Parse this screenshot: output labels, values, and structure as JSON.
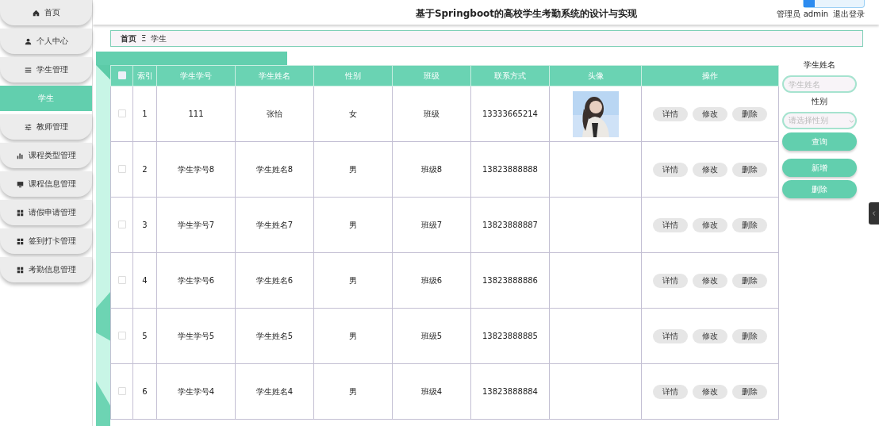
{
  "header": {
    "title": "基于Springboot的高校学生考勤系统的设计与实现",
    "user": "管理员 admin",
    "logout": "退出登录"
  },
  "sidebar": {
    "items": [
      {
        "label": "首页",
        "selected": false
      },
      {
        "label": "个人中心",
        "selected": false
      },
      {
        "label": "学生管理",
        "selected": false
      },
      {
        "label": "学生",
        "selected": true
      },
      {
        "label": "教师管理",
        "selected": false
      },
      {
        "label": "课程类型管理",
        "selected": false
      },
      {
        "label": "课程信息管理",
        "selected": false
      },
      {
        "label": "请假申请管理",
        "selected": false
      },
      {
        "label": "签到打卡管理",
        "selected": false
      },
      {
        "label": "考勤信息管理",
        "selected": false
      }
    ]
  },
  "breadcrumb": {
    "items": [
      "首页",
      "学生"
    ],
    "separator": "Ξ"
  },
  "table": {
    "columns": [
      "索引",
      "学生学号",
      "学生姓名",
      "性别",
      "班级",
      "联系方式",
      "头像",
      "操作"
    ],
    "select_all_checked": false,
    "rows": [
      {
        "checked": false,
        "cells": [
          "1",
          "111",
          "张怡",
          "女",
          "班级",
          "13333665214"
        ],
        "actions": [
          "详情",
          "修改",
          "删除"
        ]
      },
      {
        "checked": false,
        "cells": [
          "2",
          "学生学号8",
          "学生姓名8",
          "男",
          "班级8",
          "13823888888"
        ],
        "actions": [
          "详情",
          "修改",
          "删除"
        ]
      },
      {
        "checked": false,
        "cells": [
          "3",
          "学生学号7",
          "学生姓名7",
          "男",
          "班级7",
          "13823888887"
        ],
        "actions": [
          "详情",
          "修改",
          "删除"
        ]
      },
      {
        "checked": false,
        "cells": [
          "4",
          "学生学号6",
          "学生姓名6",
          "男",
          "班级6",
          "13823888886"
        ],
        "actions": [
          "详情",
          "修改",
          "删除"
        ]
      },
      {
        "checked": false,
        "cells": [
          "5",
          "学生学号5",
          "学生姓名5",
          "男",
          "班级5",
          "13823888885"
        ],
        "actions": [
          "详情",
          "修改",
          "删除"
        ]
      },
      {
        "checked": false,
        "cells": [
          "6",
          "学生学号4",
          "学生姓名4",
          "男",
          "班级4",
          "13823888884"
        ],
        "actions": [
          "详情",
          "修改",
          "删除"
        ]
      }
    ]
  },
  "search_panel": {
    "name_label": "学生姓名",
    "name_placeholder": "学生姓名",
    "gender_label": "性别",
    "gender_placeholder": "请选择性别",
    "query_button": "查询",
    "add_button": "新增",
    "delete_button": "删除"
  }
}
